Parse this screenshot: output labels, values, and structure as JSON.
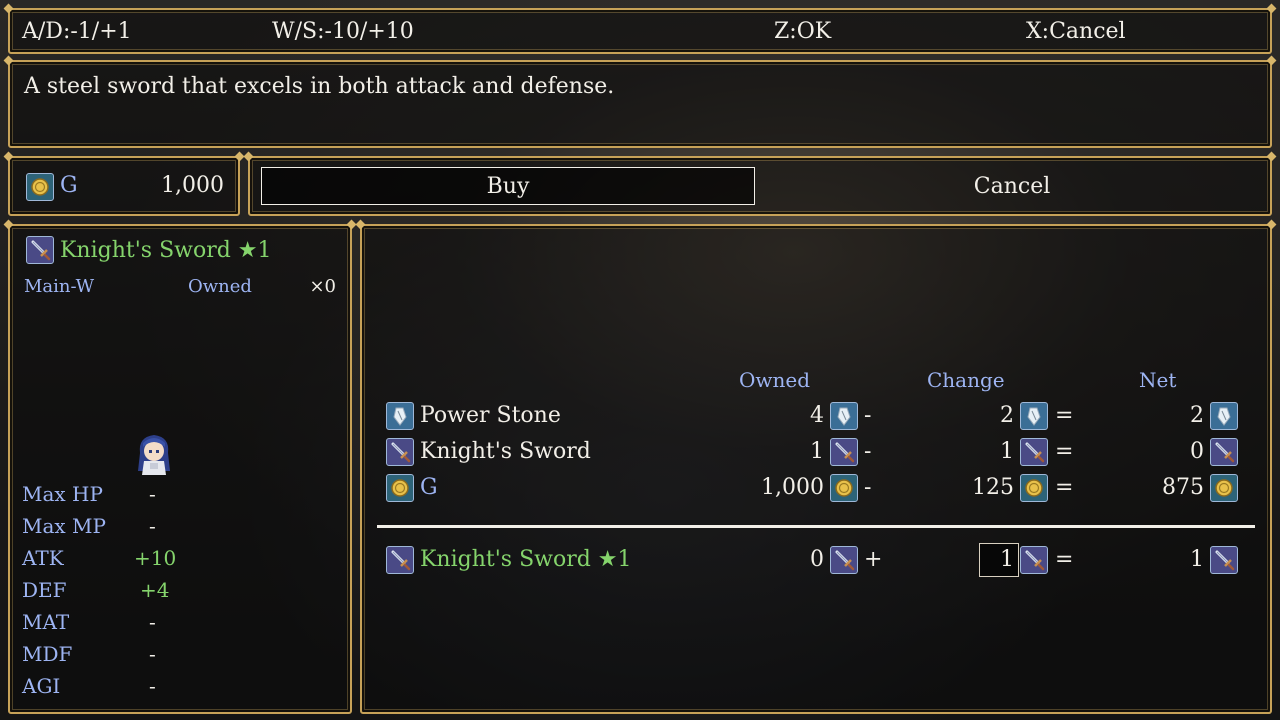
{
  "controls": {
    "ad": "A/D:-1/+1",
    "ws": "W/S:-10/+10",
    "ok": "Z:OK",
    "cancel": "X:Cancel"
  },
  "description": "A steel sword that excels in both attack and defense.",
  "gold": {
    "label": "G",
    "amount": "1,000"
  },
  "commands": {
    "buy": "Buy",
    "cancel": "Cancel"
  },
  "item": {
    "name": "Knight's Sword ★1",
    "type": "Main-W",
    "owned_label": "Owned",
    "owned_count": "×0"
  },
  "stats": [
    {
      "name": "Max HP",
      "value": "-"
    },
    {
      "name": "Max MP",
      "value": "-"
    },
    {
      "name": "ATK",
      "value": "+10"
    },
    {
      "name": "DEF",
      "value": "+4"
    },
    {
      "name": "MAT",
      "value": "-"
    },
    {
      "name": "MDF",
      "value": "-"
    },
    {
      "name": "AGI",
      "value": "-"
    }
  ],
  "table": {
    "headers": {
      "owned": "Owned",
      "change": "Change",
      "net": "Net"
    },
    "rows": [
      {
        "name": "Power Stone",
        "icon": "stone-icon",
        "owned": "4",
        "op": "-",
        "change": "2",
        "eq": "=",
        "net": "2"
      },
      {
        "name": "Knight's Sword",
        "icon": "sword-icon",
        "owned": "1",
        "op": "-",
        "change": "1",
        "eq": "=",
        "net": "0"
      },
      {
        "name": "G",
        "icon": "coin-icon",
        "owned": "1,000",
        "op": "-",
        "change": "125",
        "eq": "=",
        "net": "875"
      }
    ],
    "result": {
      "name": "Knight's Sword ★1",
      "icon": "sword-icon",
      "owned": "0",
      "op": "+",
      "change": "1",
      "eq": "=",
      "net": "1"
    }
  },
  "colors": {
    "frame": "#c7a258",
    "label_blue": "#9db4f2",
    "highlight_green": "#85d46c"
  }
}
